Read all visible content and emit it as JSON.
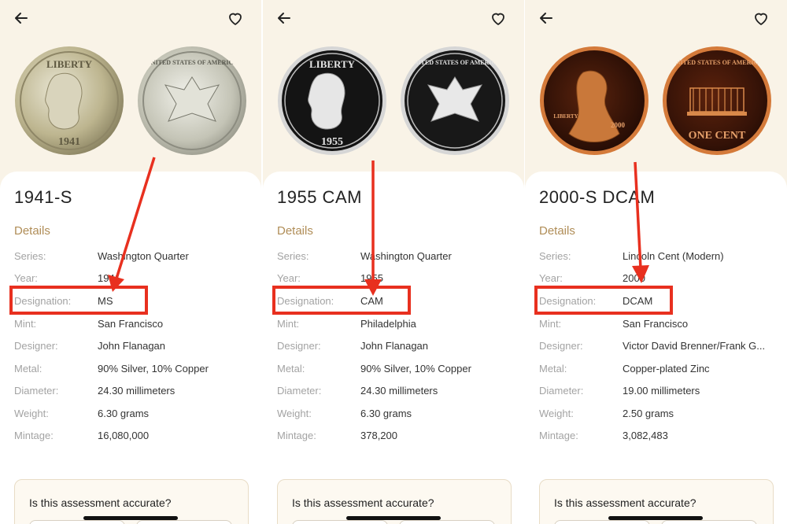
{
  "panels": [
    {
      "title": "1941-S",
      "details_heading": "Details",
      "rows": [
        {
          "key": "Series:",
          "value": "Washington Quarter"
        },
        {
          "key": "Year:",
          "value": "1941"
        },
        {
          "key": "Designation:",
          "value": "MS"
        },
        {
          "key": "Mint:",
          "value": "San Francisco"
        },
        {
          "key": "Designer:",
          "value": "John Flanagan"
        },
        {
          "key": "Metal:",
          "value": "90% Silver, 10% Copper"
        },
        {
          "key": "Diameter:",
          "value": "24.30 millimeters"
        },
        {
          "key": "Weight:",
          "value": "6.30 grams"
        },
        {
          "key": "Mintage:",
          "value": "16,080,000"
        }
      ],
      "coin": {
        "obverse_text": "LIBERTY",
        "obverse_date": "1941",
        "reverse_text": "UNITED STATES OF AMERICA",
        "colors": {
          "obverse": "#c9c2a0",
          "reverse": "#b9b9ad",
          "edge": "#8a8468"
        }
      },
      "feedback_question": "Is this assessment accurate?"
    },
    {
      "title": "1955 CAM",
      "details_heading": "Details",
      "rows": [
        {
          "key": "Series:",
          "value": "Washington Quarter"
        },
        {
          "key": "Year:",
          "value": "1955"
        },
        {
          "key": "Designation:",
          "value": "CAM"
        },
        {
          "key": "Mint:",
          "value": "Philadelphia"
        },
        {
          "key": "Designer:",
          "value": "John Flanagan"
        },
        {
          "key": "Metal:",
          "value": "90% Silver, 10% Copper"
        },
        {
          "key": "Diameter:",
          "value": "24.30 millimeters"
        },
        {
          "key": "Weight:",
          "value": "6.30 grams"
        },
        {
          "key": "Mintage:",
          "value": "378,200"
        }
      ],
      "coin": {
        "obverse_text": "LIBERTY",
        "obverse_date": "1955",
        "reverse_text": "UNITED STATES OF AMERICA",
        "colors": {
          "obverse": "#1c1c1c",
          "reverse": "#232323",
          "edge": "#d7d7d7"
        }
      },
      "feedback_question": "Is this assessment accurate?"
    },
    {
      "title": "2000-S DCAM",
      "details_heading": "Details",
      "rows": [
        {
          "key": "Series:",
          "value": "Lincoln Cent (Modern)"
        },
        {
          "key": "Year:",
          "value": "2000"
        },
        {
          "key": "Designation:",
          "value": "DCAM"
        },
        {
          "key": "Mint:",
          "value": "San Francisco"
        },
        {
          "key": "Designer:",
          "value": "Victor David Brenner/Frank G..."
        },
        {
          "key": "Metal:",
          "value": "Copper-plated Zinc"
        },
        {
          "key": "Diameter:",
          "value": "19.00 millimeters"
        },
        {
          "key": "Weight:",
          "value": "2.50 grams"
        },
        {
          "key": "Mintage:",
          "value": "3,082,483"
        }
      ],
      "coin": {
        "obverse_text": "LIBERTY",
        "obverse_date": "2000",
        "reverse_text": "UNITED STATES OF AMERICA",
        "reverse_bottom": "ONE CENT",
        "colors": {
          "obverse": "#3a1508",
          "reverse": "#4a1b0b",
          "edge": "#c8642e"
        }
      },
      "feedback_question": "Is this assessment accurate?"
    }
  ],
  "icons": {
    "back": "back-arrow-icon",
    "favorite": "heart-icon"
  },
  "colors": {
    "background": "#f9f3e7",
    "accent_gold": "#b08d57",
    "highlight_red": "#e8301f",
    "label_gray": "#a3a3a3"
  }
}
